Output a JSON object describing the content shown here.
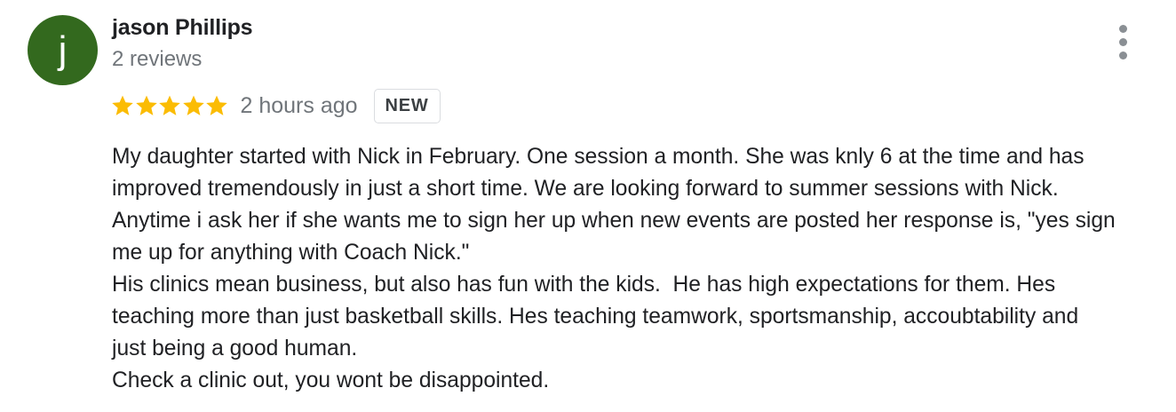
{
  "reviewer": {
    "avatar_letter": "j",
    "avatar_color": "#33691e",
    "name": "jason Phillips",
    "subtitle": "2 reviews"
  },
  "review": {
    "rating": 5,
    "rating_max": 5,
    "star_color": "#fbbc04",
    "time": "2 hours ago",
    "badge": "NEW",
    "lines": [
      "My daughter started with Nick in February. One session a month. She was knly 6 at the time and has",
      "improved tremendously in just a short time. We are looking forward to summer sessions with Nick.",
      "Anytime i ask her if she wants me to sign her up when new events are posted her response is, \"yes sign",
      "me up for anything with Coach Nick.\"",
      "His clinics mean business, but also has fun with the kids.  He has high expectations for them. Hes",
      "teaching more than just basketball skills. Hes teaching teamwork, sportsmanship, accoubtability and",
      "just being a good human.",
      "Check a clinic out, you wont be disappointed."
    ]
  },
  "icons": {
    "menu": "more-vert-icon",
    "star": "star-icon"
  }
}
